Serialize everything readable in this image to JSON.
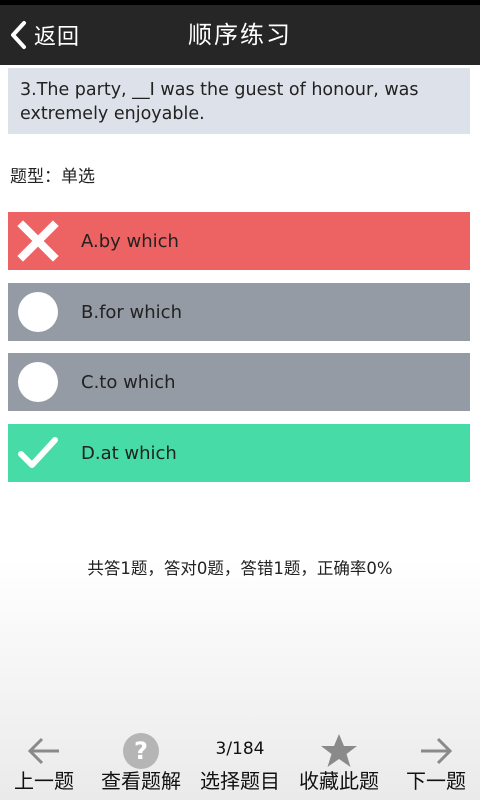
{
  "header": {
    "back_label": "返回",
    "title": "顺序练习"
  },
  "question": {
    "text": "3.The party, __I was the guest of honour, was extremely enjoyable.",
    "type_label": "题型：单选"
  },
  "options": [
    {
      "label": "A.by which",
      "state": "wrong",
      "icon": "cross-icon",
      "color": "#ed6262"
    },
    {
      "label": "B.for which",
      "state": "neutral",
      "icon": "circle-icon",
      "color": "#959ba4"
    },
    {
      "label": "C.to which",
      "state": "neutral",
      "icon": "circle-icon",
      "color": "#959ba4"
    },
    {
      "label": "D.at which",
      "state": "correct",
      "icon": "check-icon",
      "color": "#47dba7"
    }
  ],
  "stats": "共答1题，答对0题，答错1题，正确率0%",
  "bottom_nav": {
    "prev_label": "上一题",
    "explain_label": "查看题解",
    "counter": "3/184",
    "select_label": "选择题目",
    "favorite_label": "收藏此题",
    "next_label": "下一题"
  },
  "icons": {
    "back": "chevron-left-icon",
    "prev": "arrow-left-icon",
    "explain": "question-mark-icon",
    "favorite": "star-icon",
    "next": "arrow-right-icon"
  }
}
